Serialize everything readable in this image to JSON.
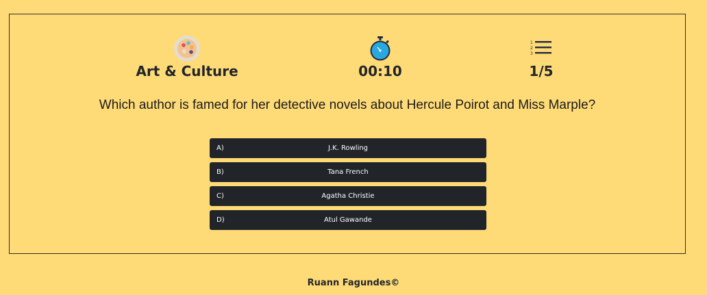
{
  "stats": {
    "category": "Art & Culture",
    "timer": "00:10",
    "progress": "1/5"
  },
  "icons": {
    "category": "palette-icon",
    "timer": "stopwatch-icon",
    "progress": "numbered-list-icon"
  },
  "question": "Which author is famed for her detective novels about Hercule Poirot and Miss Marple?",
  "answers": [
    {
      "letter": "A)",
      "text": "J.K. Rowling"
    },
    {
      "letter": "B)",
      "text": "Tana French"
    },
    {
      "letter": "C)",
      "text": "Agatha Christie"
    },
    {
      "letter": "D)",
      "text": "Atul Gawande"
    }
  ],
  "footer": "Ruann Fagundes©",
  "colors": {
    "background": "#ffdb78",
    "button": "#212529",
    "stopwatch": "#29a8e0"
  }
}
